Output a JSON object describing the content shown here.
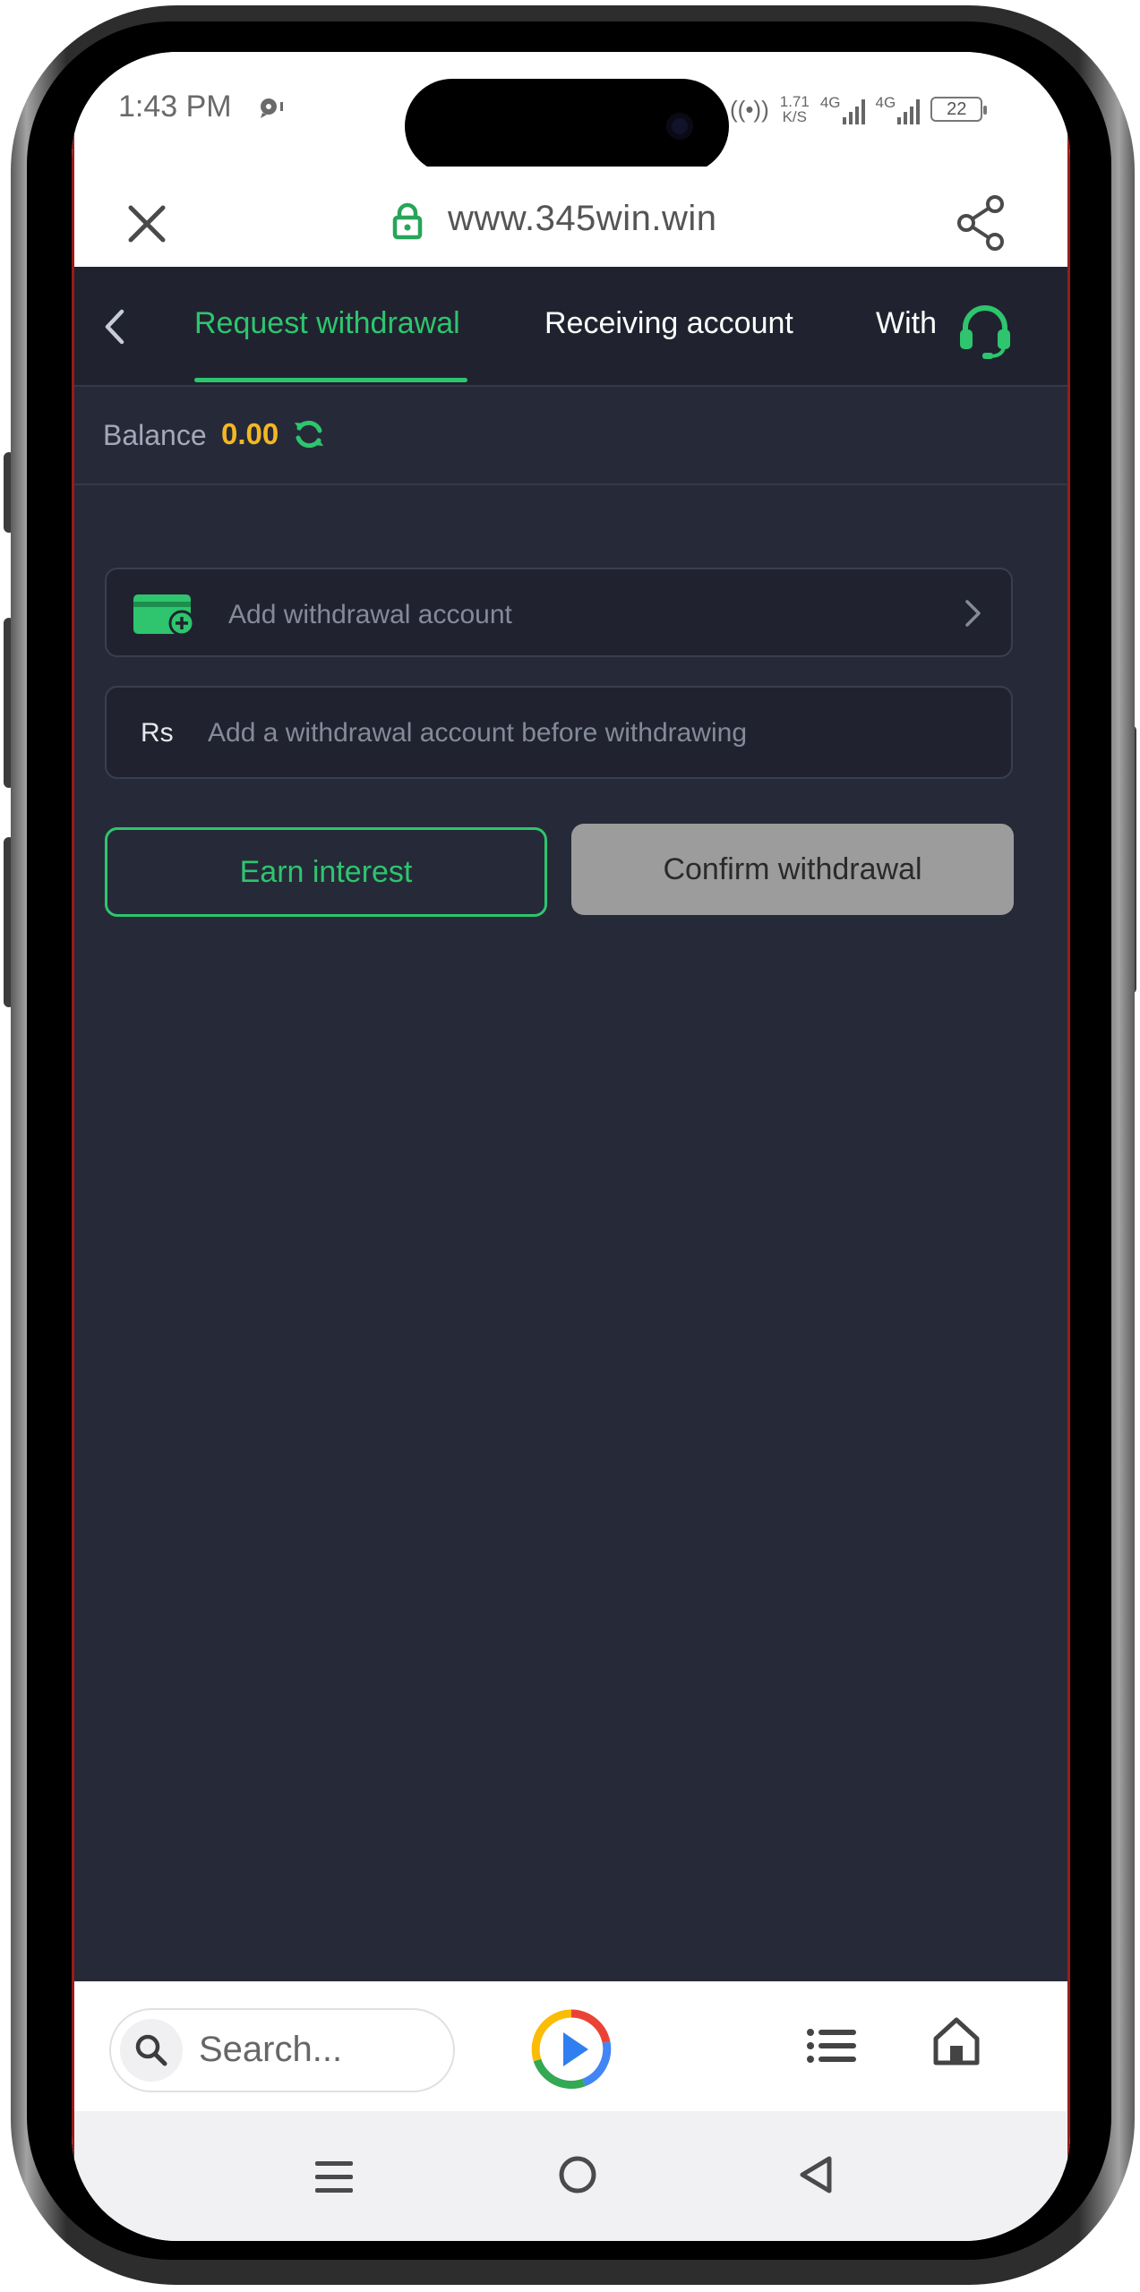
{
  "status_bar": {
    "time": "1:43 PM",
    "speed_value": "1.71",
    "speed_unit": "K/S",
    "network_1": "4G",
    "network_2": "4G",
    "battery": "22"
  },
  "browser": {
    "url": "www.345win.win",
    "search_placeholder": "Search..."
  },
  "tabs": {
    "items": [
      "Request withdrawal",
      "Receiving account",
      "With"
    ],
    "active_index": 0
  },
  "balance": {
    "label": "Balance",
    "value": "0.00"
  },
  "withdrawal_account": {
    "label": "Add withdrawal account"
  },
  "amount": {
    "currency": "Rs",
    "placeholder": "Add a withdrawal account before withdrawing"
  },
  "buttons": {
    "earn_interest": "Earn interest",
    "confirm_withdrawal": "Confirm withdrawal"
  },
  "colors": {
    "accent_green": "#2ec56e",
    "balance_yellow": "#f4b724",
    "page_background": "#262a38",
    "disabled_button": "#9c9c9c"
  },
  "icons": {
    "close": "close-icon",
    "lock": "lock-icon",
    "share": "share-icon",
    "back": "chevron-left-icon",
    "support": "headset-icon",
    "refresh": "refresh-icon",
    "wallet": "wallet-add-icon",
    "chevron": "chevron-right-icon",
    "search": "search-icon",
    "browser_logo": "play-logo-icon",
    "list": "list-icon",
    "home": "home-icon"
  }
}
